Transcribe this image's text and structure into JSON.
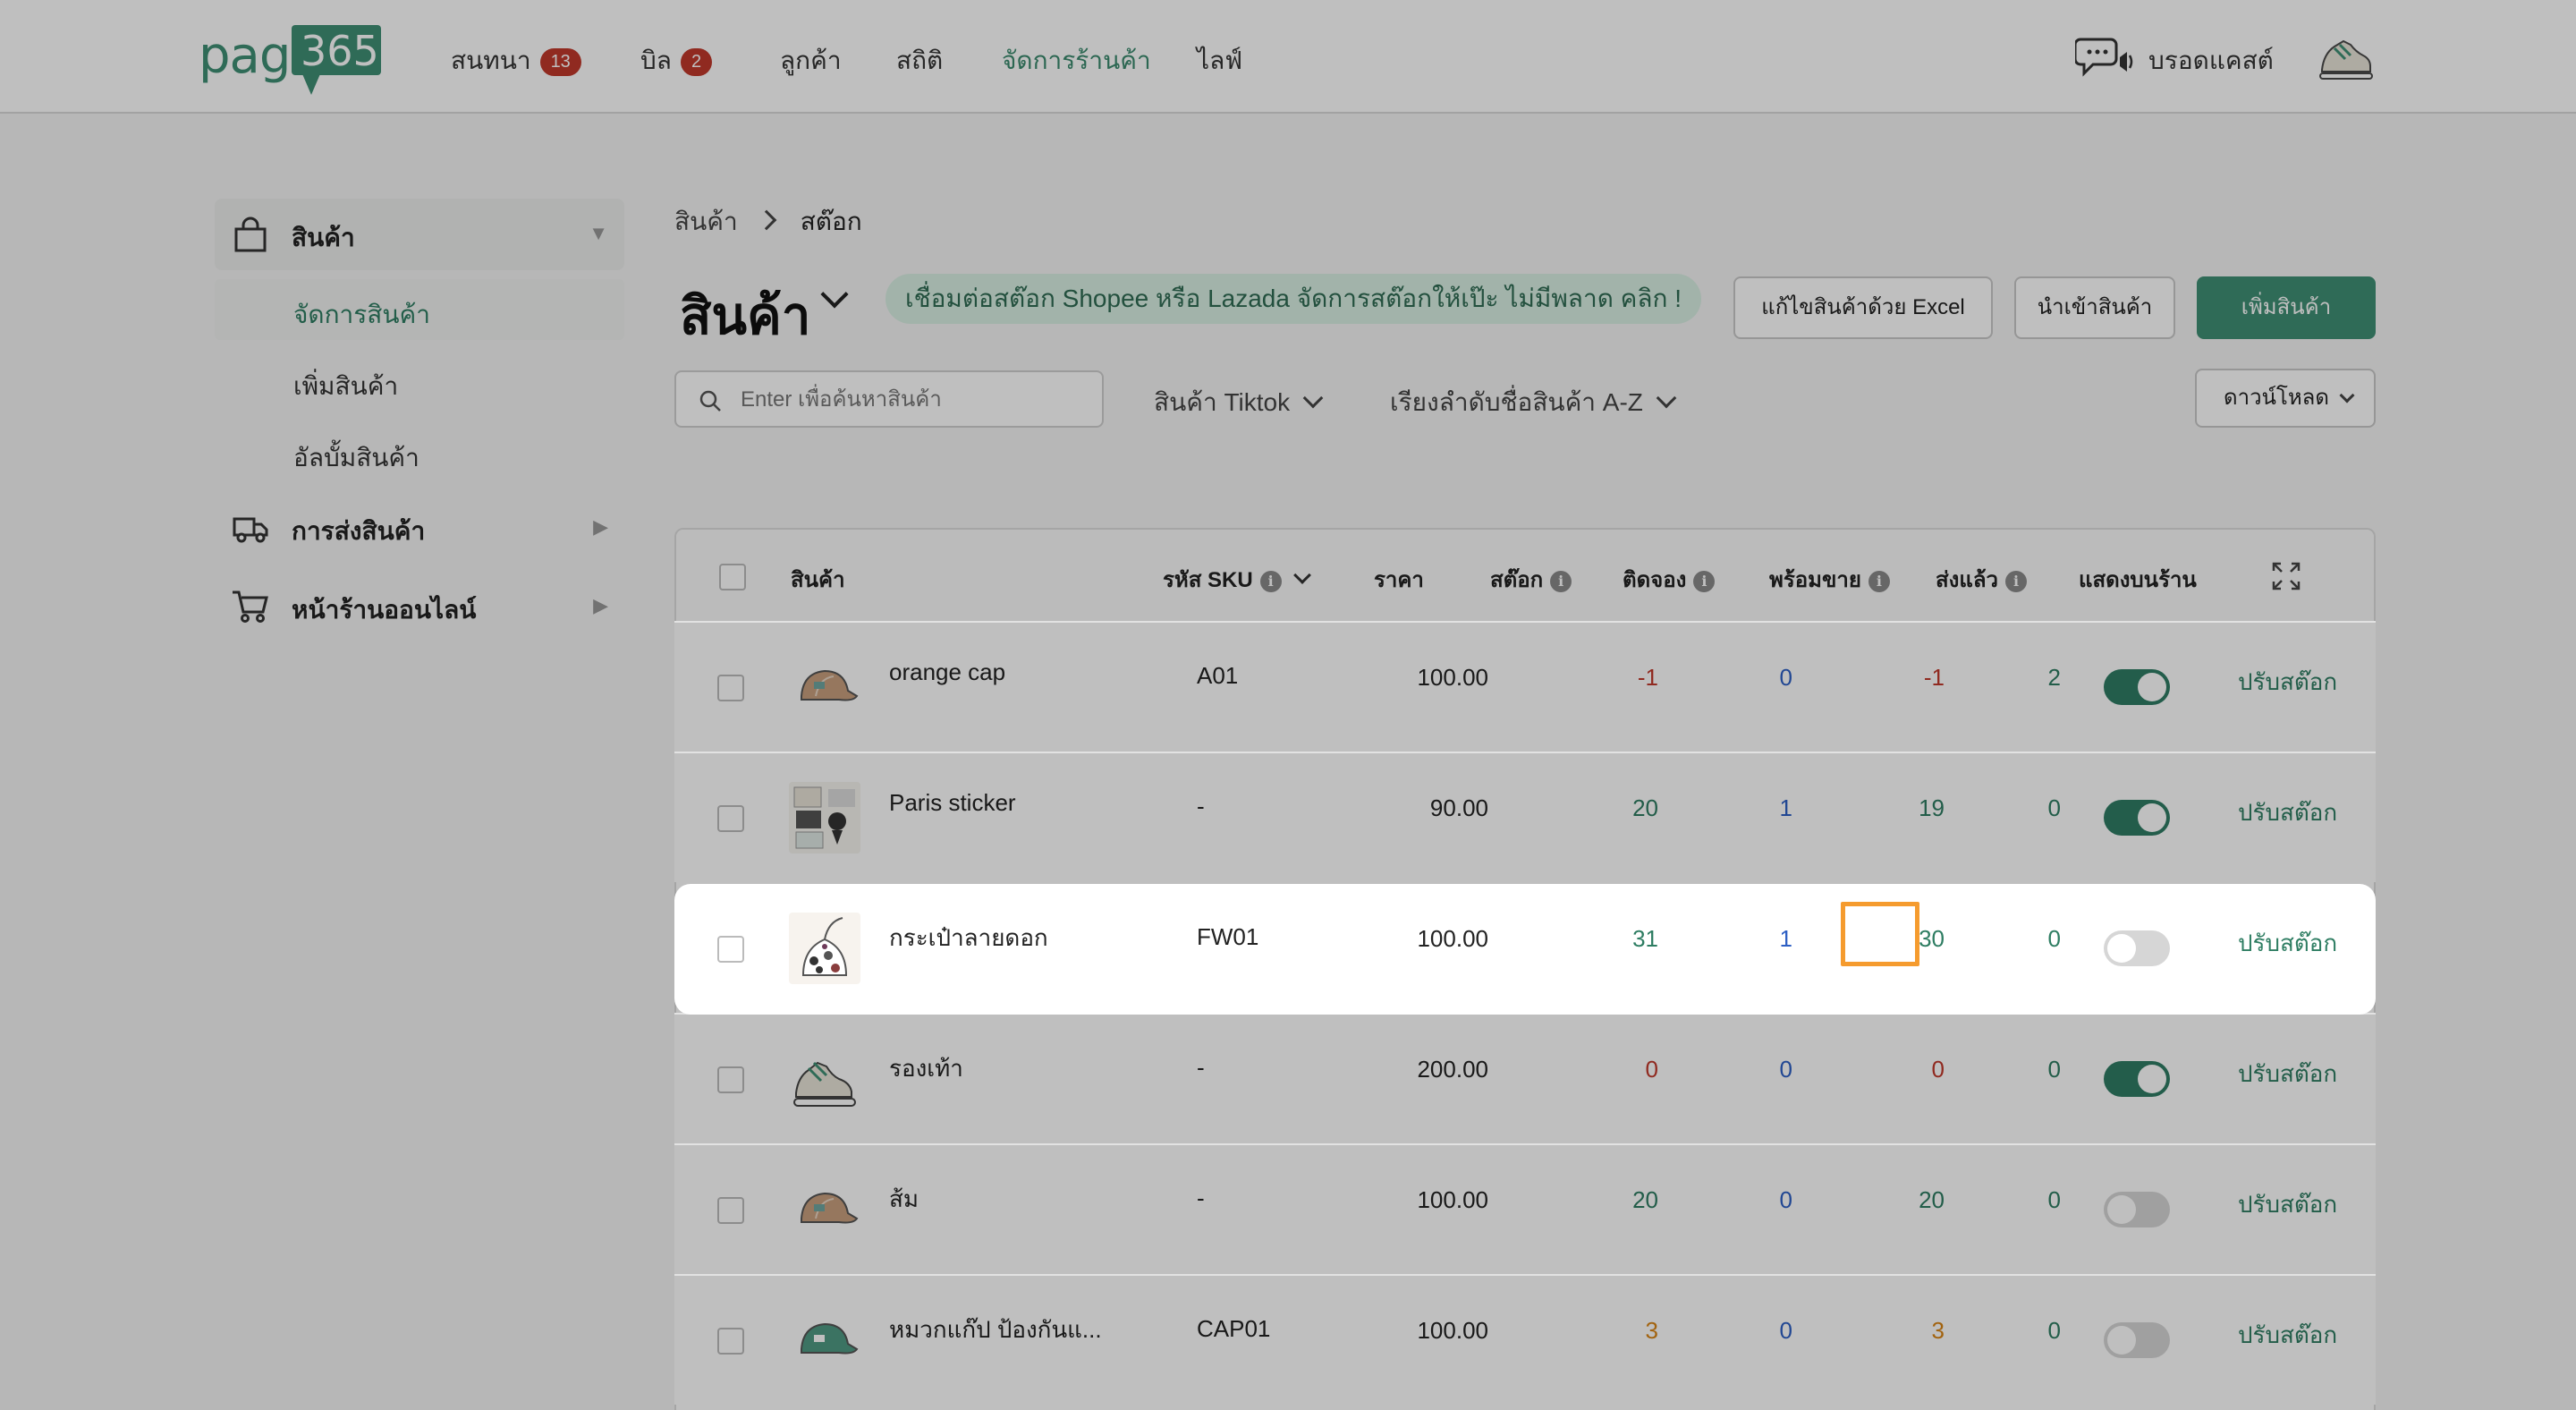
{
  "header": {
    "logo_text": "page",
    "logo_number": "365",
    "nav": [
      {
        "label": "สนทนา",
        "badge": "13"
      },
      {
        "label": "บิล",
        "badge": "2"
      },
      {
        "label": "ลูกค้า"
      },
      {
        "label": "สถิติ"
      },
      {
        "label": "จัดการร้านค้า",
        "active": true
      },
      {
        "label": "ไลฟ์"
      }
    ],
    "broadcast_label": "บรอดแคสต์"
  },
  "sidebar": {
    "groups": [
      {
        "label": "สินค้า",
        "icon": "bag-icon",
        "expanded": true,
        "items": [
          "จัดการสินค้า",
          "เพิ่มสินค้า",
          "อัลบั้มสินค้า"
        ]
      },
      {
        "label": "การส่งสินค้า",
        "icon": "truck-icon"
      },
      {
        "label": "หน้าร้านออนไลน์",
        "icon": "cart-icon"
      }
    ]
  },
  "breadcrumb": [
    "สินค้า",
    "สต๊อก"
  ],
  "page_title": "สินค้า",
  "promo_text": "เชื่อมต่อสต๊อก Shopee หรือ Lazada จัดการสต๊อกให้เป๊ะ ไม่มีพลาด คลิก !",
  "actions": {
    "excel": "แก้ไขสินค้าด้วย Excel",
    "import": "นำเข้าสินค้า",
    "add": "เพิ่มสินค้า"
  },
  "search": {
    "placeholder": "Enter เพื่อค้นหาสินค้า",
    "value": ""
  },
  "filters": {
    "channel": "สินค้า Tiktok",
    "sort": "เรียงลำดับชื่อสินค้า A-Z",
    "download": "ดาวน์โหลด"
  },
  "table": {
    "headers": {
      "product": "สินค้า",
      "sku": "รหัส SKU",
      "price": "ราคา",
      "stock": "สต๊อก",
      "reserved": "ติดจอง",
      "ready": "พร้อมขาย",
      "shipped": "ส่งแล้ว",
      "show": "แสดงบนร้าน"
    },
    "adjust_label": "ปรับสต๊อก",
    "rows": [
      {
        "name": "orange cap",
        "sku": "A01",
        "price": "100.00",
        "stock": "-1",
        "reserved": "0",
        "ready": "-1",
        "shipped": "2",
        "show": true,
        "thumb": "cap-orange"
      },
      {
        "name": "Paris sticker",
        "sku": "-",
        "price": "90.00",
        "stock": "20",
        "reserved": "1",
        "ready": "19",
        "shipped": "0",
        "show": true,
        "thumb": "sticker"
      },
      {
        "name": "กระเป๋าลายดอก",
        "sku": "FW01",
        "price": "100.00",
        "stock": "31",
        "reserved": "1",
        "ready": "30",
        "shipped": "0",
        "show": false,
        "thumb": "bag"
      },
      {
        "name": "รองเท้า",
        "sku": "-",
        "price": "200.00",
        "stock": "0",
        "reserved": "0",
        "ready": "0",
        "shipped": "0",
        "show": true,
        "thumb": "shoe"
      },
      {
        "name": "ส้ม",
        "sku": "-",
        "price": "100.00",
        "stock": "20",
        "reserved": "0",
        "ready": "20",
        "shipped": "0",
        "show": false,
        "thumb": "cap-orange"
      },
      {
        "name": "หมวกแก๊ป ป้องกันแ...",
        "sku": "CAP01",
        "price": "100.00",
        "stock": "3",
        "reserved": "0",
        "ready": "3",
        "shipped": "0",
        "show": false,
        "thumb": "cap-green"
      }
    ]
  },
  "colors": {
    "brand": "#3f8f74",
    "negative": "#c0392b",
    "reserved": "#2d5fc4",
    "positive": "#2e7d62",
    "low": "#d98514",
    "highlight": "#f59b2e"
  }
}
